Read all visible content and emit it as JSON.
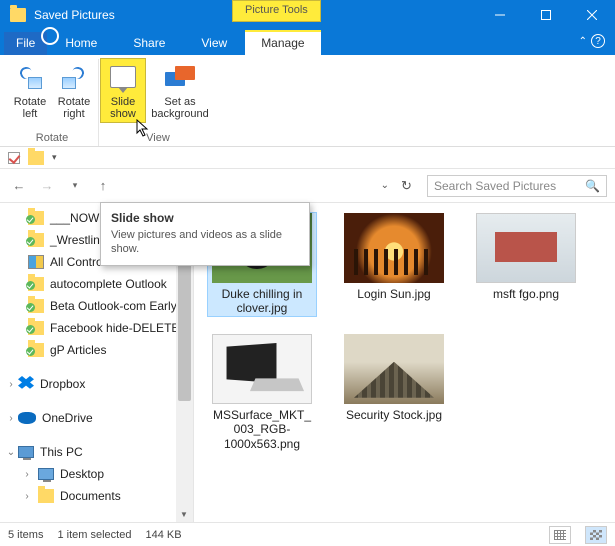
{
  "window": {
    "title": "Saved Pictures",
    "contextual_tab": "Picture Tools"
  },
  "menu": {
    "file": "File",
    "home": "Home",
    "share": "Share",
    "view": "View",
    "manage": "Manage"
  },
  "ribbon": {
    "rotate_left": "Rotate left",
    "rotate_right": "Rotate right",
    "slide_show": "Slide show",
    "set_bg": "Set as background",
    "group_rotate": "Rotate",
    "group_view": "View"
  },
  "tooltip": {
    "title": "Slide show",
    "body": "View pictures and videos as a slide show."
  },
  "search": {
    "placeholder": "Search Saved Pictures"
  },
  "tree": {
    "items": [
      {
        "label": "___NOW"
      },
      {
        "label": "_Wrestling and MMA"
      },
      {
        "label": "All Control Panel Items"
      },
      {
        "label": "autocomplete Outlook"
      },
      {
        "label": "Beta Outlook-com Early"
      },
      {
        "label": "Facebook hide-DELETE"
      },
      {
        "label": "gP Articles"
      }
    ],
    "dropbox": "Dropbox",
    "onedrive": "OneDrive",
    "thispc": "This PC",
    "desktop": "Desktop",
    "documents": "Documents"
  },
  "files": [
    {
      "label": "Duke chilling in clover.jpg"
    },
    {
      "label": "Login Sun.jpg"
    },
    {
      "label": "msft fgo.png"
    },
    {
      "label": "MSSurface_MKT_003_RGB-1000x563.png"
    },
    {
      "label": "Security Stock.jpg"
    }
  ],
  "status": {
    "count": "5 items",
    "selected": "1 item selected",
    "size": "144 KB"
  }
}
